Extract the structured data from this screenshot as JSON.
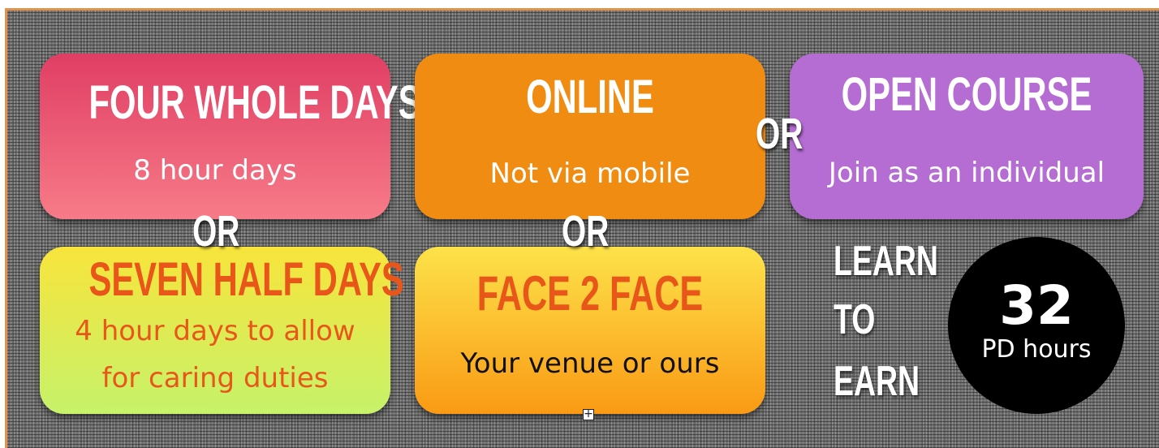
{
  "cards": {
    "four_whole_days": {
      "title": "FOUR WHOLE DAYS",
      "subtitle": "8 hour days"
    },
    "online": {
      "title": "ONLINE",
      "subtitle": "Not via mobile"
    },
    "open_course": {
      "title": "OPEN COURSE",
      "subtitle": "Join as an individual"
    },
    "seven_half_days": {
      "title": "SEVEN HALF DAYS",
      "subtitle_line1": "4 hour days to allow",
      "subtitle_line2": "for caring duties"
    },
    "face_2_face": {
      "title": "FACE 2 FACE",
      "subtitle": "Your venue or ours"
    }
  },
  "connectors": {
    "or": "OR"
  },
  "learn_to_earn": {
    "line1": "LEARN",
    "line2": "TO",
    "line3": "EARN"
  },
  "pd_badge": {
    "number": "32",
    "label": "PD hours"
  },
  "colors": {
    "card_red": "#e03e64",
    "card_orange": "#f08c12",
    "card_purple": "#b56cd3",
    "card_yellow_green": "#f8e43c",
    "card_yellow_orange": "#fa9a14",
    "accent_orange_text": "#e8561a",
    "border": "#e0934a"
  },
  "icons": {
    "handle": "plus-square-icon"
  }
}
